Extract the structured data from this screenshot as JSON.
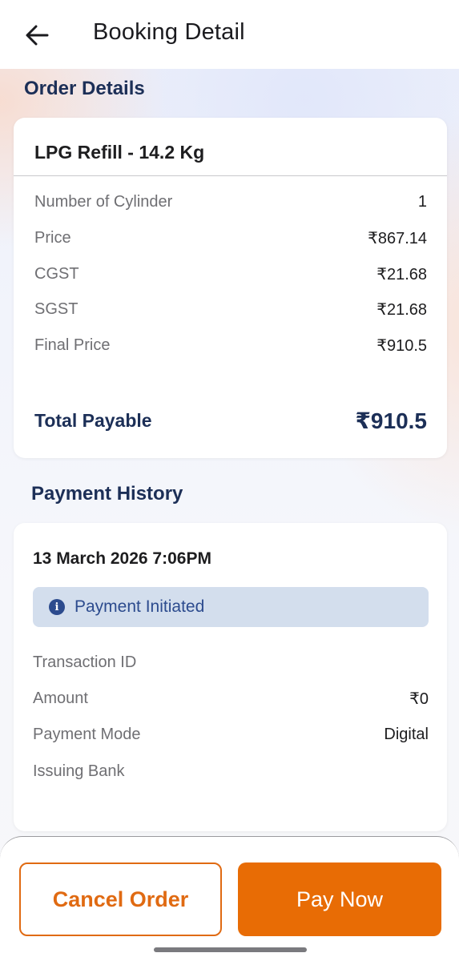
{
  "header": {
    "title": "Booking Detail",
    "back_icon": "arrow-left-icon"
  },
  "order_section": {
    "title": "Order Details",
    "product": "LPG Refill - 14.2 Kg",
    "rows": [
      {
        "label": "Number of Cylinder",
        "value": "1"
      },
      {
        "label": "Price",
        "value": "₹867.14"
      },
      {
        "label": "CGST",
        "value": "₹21.68"
      },
      {
        "label": "SGST",
        "value": "₹21.68"
      },
      {
        "label": "Final Price",
        "value": "₹910.5"
      }
    ],
    "total_label": "Total Payable",
    "total_value": "₹910.5"
  },
  "payment_section": {
    "title": "Payment History",
    "date": "13 March 2026 7:06PM",
    "status": "Payment Initiated",
    "status_icon": "info-icon",
    "rows": [
      {
        "label": "Transaction ID",
        "value": ""
      },
      {
        "label": "Amount",
        "value": "₹0"
      },
      {
        "label": "Payment Mode",
        "value": "Digital"
      },
      {
        "label": "Issuing Bank",
        "value": ""
      }
    ]
  },
  "actions": {
    "cancel_label": "Cancel Order",
    "pay_label": "Pay Now"
  },
  "colors": {
    "primary": "#e86c05",
    "navy": "#1c2f57",
    "status_bg": "#d3deed"
  }
}
